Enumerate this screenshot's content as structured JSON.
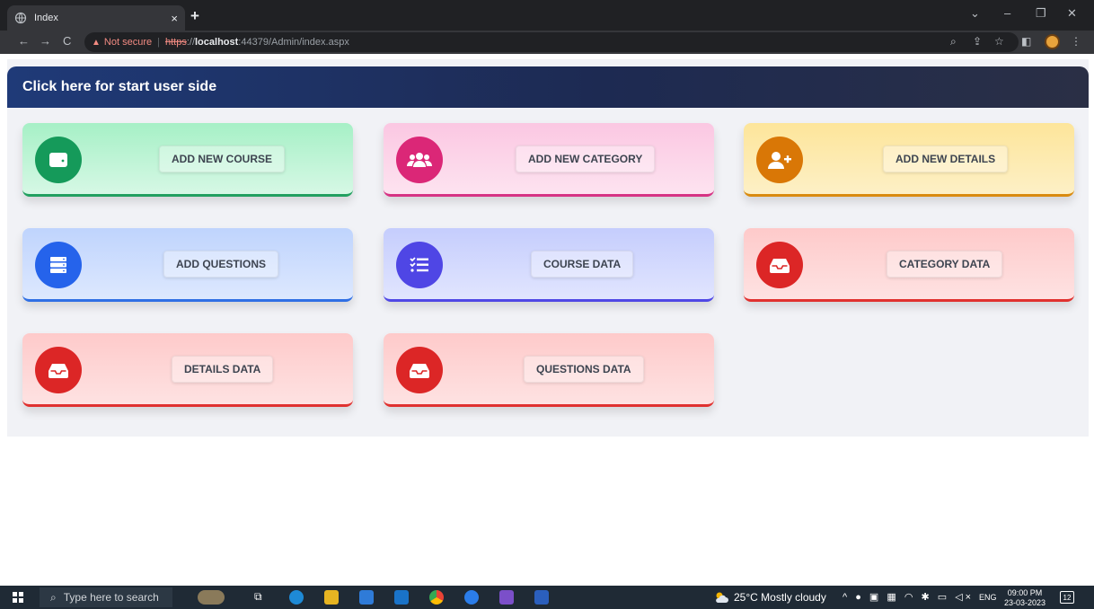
{
  "browser": {
    "tab_title": "Index",
    "tab_close": "×",
    "new_tab": "+",
    "security_label": "Not secure",
    "url_scheme": "https",
    "url_sep": "://",
    "url_host": "localhost",
    "url_path": ":44379/Admin/index.aspx"
  },
  "banner": {
    "label": "Click here for start user side"
  },
  "cards": [
    {
      "label": "ADD NEW COURSE",
      "icon": "wallet-icon",
      "icon_color": "#159a5a",
      "theme": "green"
    },
    {
      "label": "ADD NEW CATEGORY",
      "icon": "users-icon",
      "icon_color": "#db2777",
      "theme": "pink"
    },
    {
      "label": "ADD NEW DETAILS",
      "icon": "user-plus-icon",
      "icon_color": "#d97706",
      "theme": "yellow"
    },
    {
      "label": "ADD QUESTIONS",
      "icon": "server-icon",
      "icon_color": "#2563eb",
      "theme": "blue"
    },
    {
      "label": "COURSE DATA",
      "icon": "list-check-icon",
      "icon_color": "#4f46e5",
      "theme": "violet"
    },
    {
      "label": "CATEGORY DATA",
      "icon": "inbox-icon",
      "icon_color": "#dc2626",
      "theme": "red"
    },
    {
      "label": "DETAILS DATA",
      "icon": "inbox-icon",
      "icon_color": "#dc2626",
      "theme": "red"
    },
    {
      "label": "QUESTIONS DATA",
      "icon": "inbox-icon",
      "icon_color": "#dc2626",
      "theme": "red"
    }
  ],
  "taskbar": {
    "search_placeholder": "Type here to search",
    "weather": "25°C  Mostly cloudy",
    "language": "ENG",
    "time": "09:00 PM",
    "date": "23-03-2023",
    "notifications": "12"
  }
}
